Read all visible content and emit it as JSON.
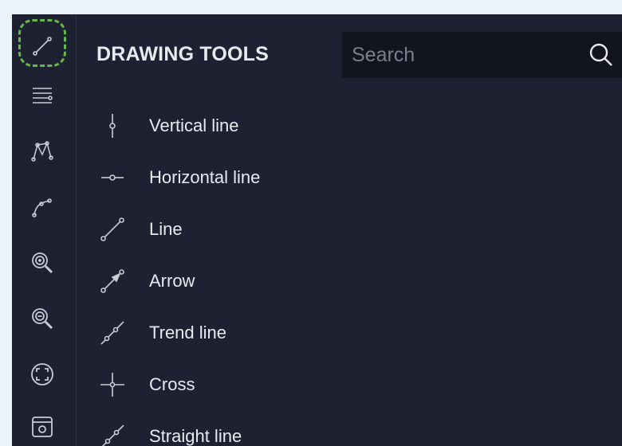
{
  "panel": {
    "title": "DRAWING TOOLS",
    "search_placeholder": "Search"
  },
  "rail": {
    "items": [
      {
        "icon": "line-tool-icon",
        "active": true
      },
      {
        "icon": "horizontal-lines-icon"
      },
      {
        "icon": "pattern-icon"
      },
      {
        "icon": "curve-icon"
      },
      {
        "icon": "zoom-in-icon"
      },
      {
        "icon": "zoom-out-icon"
      },
      {
        "icon": "focus-icon"
      },
      {
        "icon": "screenshot-icon"
      }
    ]
  },
  "tools": [
    {
      "label": "Vertical line",
      "icon": "vertical-line-icon"
    },
    {
      "label": "Horizontal line",
      "icon": "horizontal-line-icon"
    },
    {
      "label": "Line",
      "icon": "line-icon"
    },
    {
      "label": "Arrow",
      "icon": "arrow-icon"
    },
    {
      "label": "Trend line",
      "icon": "trend-line-icon"
    },
    {
      "label": "Cross",
      "icon": "cross-icon"
    },
    {
      "label": "Straight line",
      "icon": "straight-line-icon"
    }
  ],
  "colors": {
    "background": "#1e2131",
    "search_bg": "#12141f",
    "active_outline": "#65b94a",
    "text": "#e8eaf0",
    "icon": "#c8cbd4"
  }
}
